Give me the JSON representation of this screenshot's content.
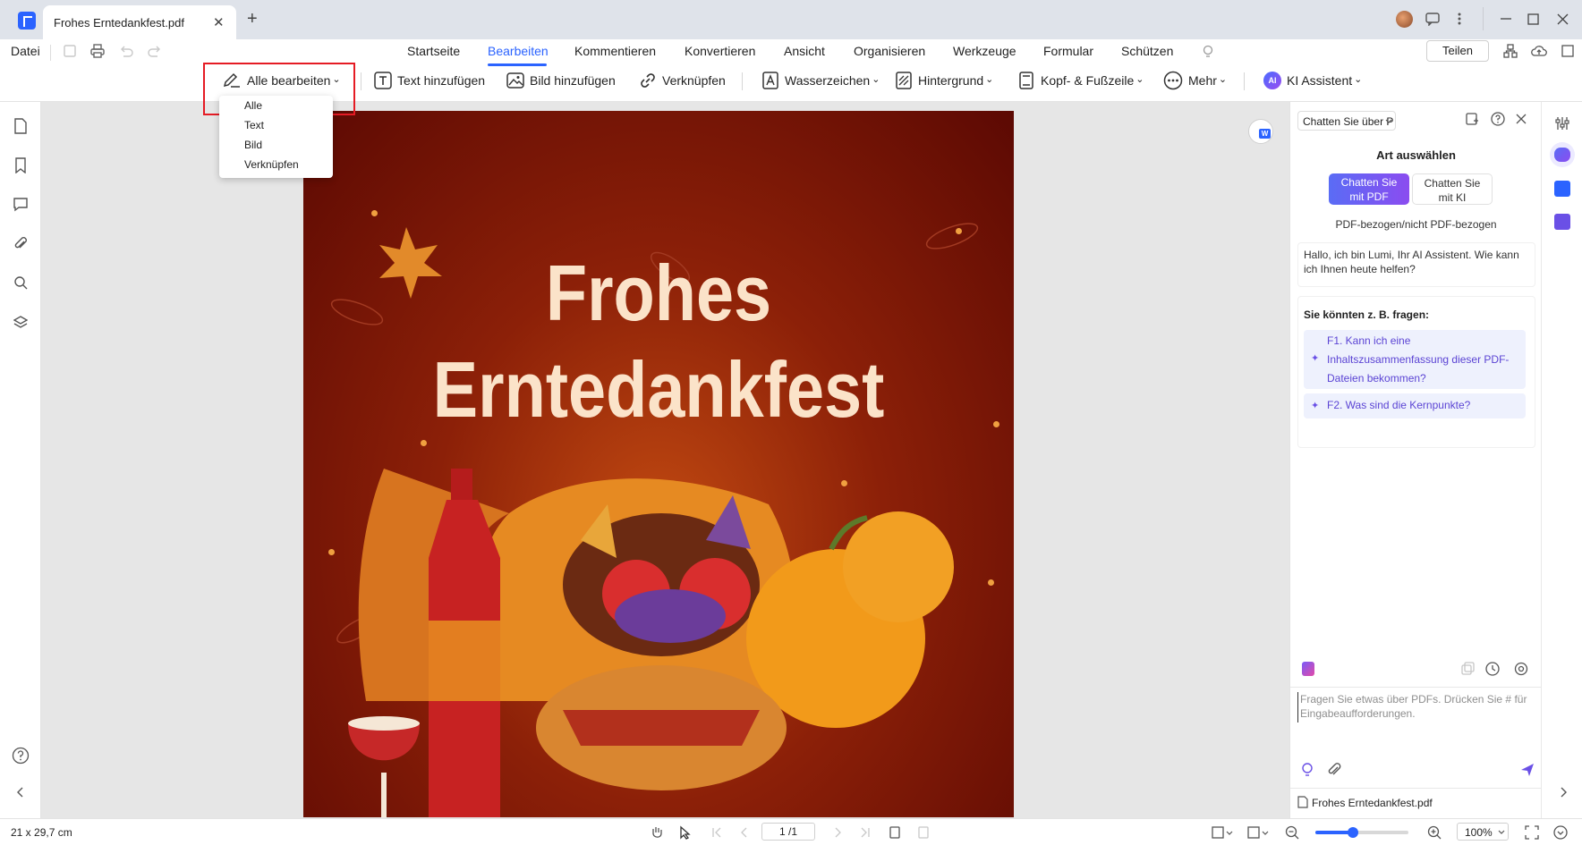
{
  "titlebar": {
    "tab_title": "Frohes Erntedankfest.pdf",
    "close_glyph": "✕",
    "new_tab_glyph": "+"
  },
  "menubar": {
    "file_label": "Datei",
    "tabs": [
      "Startseite",
      "Bearbeiten",
      "Kommentieren",
      "Konvertieren",
      "Ansicht",
      "Organisieren",
      "Werkzeuge",
      "Formular",
      "Schützen"
    ],
    "active_tab": "Bearbeiten",
    "share_label": "Teilen"
  },
  "toolbar": {
    "edit_all_label": "Alle bearbeiten",
    "add_text_label": "Text hinzufügen",
    "add_image_label": "Bild hinzufügen",
    "link_label": "Verknüpfen",
    "watermark_label": "Wasserzeichen",
    "background_label": "Hintergrund",
    "header_footer_label": "Kopf- & Fußzeile",
    "more_label": "Mehr",
    "ai_badge": "AI",
    "ai_label": "KI Assistent",
    "caret": "⌄"
  },
  "dropdown": {
    "items": [
      "Alle",
      "Text",
      "Bild",
      "Verknüpfen"
    ]
  },
  "document": {
    "title_line1": "Frohes",
    "title_line2": "Erntedankfest"
  },
  "ai_panel": {
    "chat_select": "Chatten Sie über P",
    "choose_heading": "Art auswählen",
    "mode_pdf": "Chatten Sie mit PDF",
    "mode_ai": "Chatten Sie mit KI",
    "mode_subtitle": "PDF-bezogen/nicht PDF-bezogen",
    "greeting": "Hallo, ich bin Lumi, Ihr AI Assistent. Wie kann ich Ihnen heute helfen?",
    "suggest_heading": "Sie könnten z. B. fragen:",
    "suggestions": [
      "F1. Kann ich eine Inhaltszusammenfassung dieser PDF-Dateien bekommen?",
      "F2. Was sind die Kernpunkte?"
    ],
    "input_placeholder": "Fragen Sie etwas über PDFs. Drücken Sie # für Eingabeaufforderungen.",
    "file_name": "Frohes Erntedankfest.pdf",
    "accent_color": "#6a50e6"
  },
  "statusbar": {
    "page_size": "21 x 29,7 cm",
    "page_indicator": "1 /1",
    "zoom": "100%",
    "zoom_level": 0.4
  },
  "colors": {
    "brand_blue": "#2b63ff",
    "highlight_red": "#e51b24"
  }
}
